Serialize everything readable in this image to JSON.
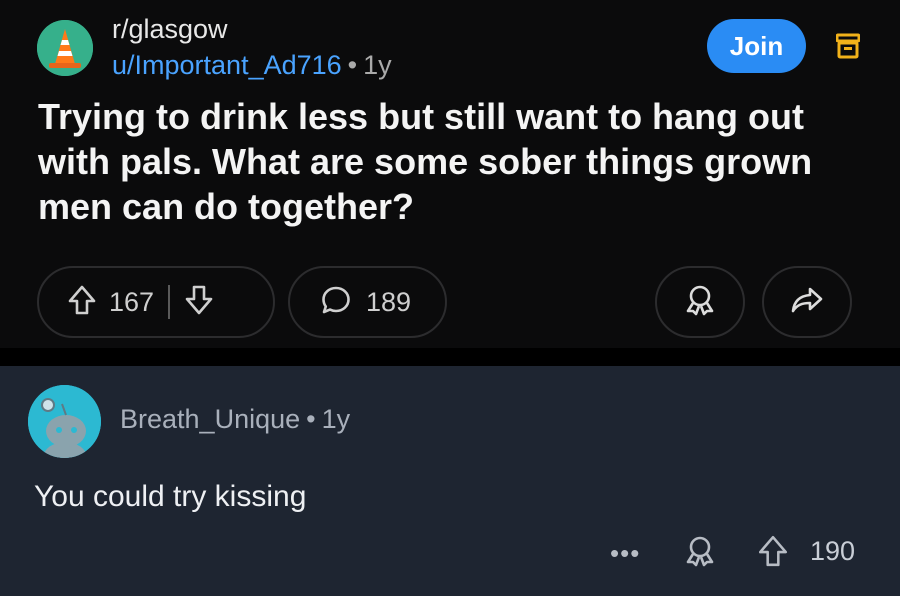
{
  "post": {
    "subreddit": "r/glasgow",
    "author": "u/Important_Ad716",
    "separator": "•",
    "age": "1y",
    "join_label": "Join",
    "title": "Trying to drink less but still want to hang out with pals. What are some sober things grown men can do together?",
    "upvotes": "167",
    "comments": "189",
    "icons": {
      "avatar": "traffic-cone-icon",
      "archive": "archive-icon",
      "upvote": "upvote-arrow-icon",
      "downvote": "downvote-arrow-icon",
      "comments": "comment-bubble-icon",
      "award": "award-ribbon-icon",
      "share": "share-arrow-icon"
    }
  },
  "comment": {
    "author": "Breath_Unique",
    "separator": "•",
    "age": "1y",
    "body": "You could try kissing",
    "more_label": "•••",
    "upvotes": "190",
    "icons": {
      "avatar": "snoo-avatar-icon",
      "award": "award-ribbon-icon",
      "upvote": "upvote-arrow-icon"
    }
  },
  "colors": {
    "accent": "#2a8cf4",
    "author_link": "#4aa3ff",
    "archive": "#f2b21a",
    "post_bg": "#0b0b0c",
    "comment_bg": "#1e2531"
  }
}
